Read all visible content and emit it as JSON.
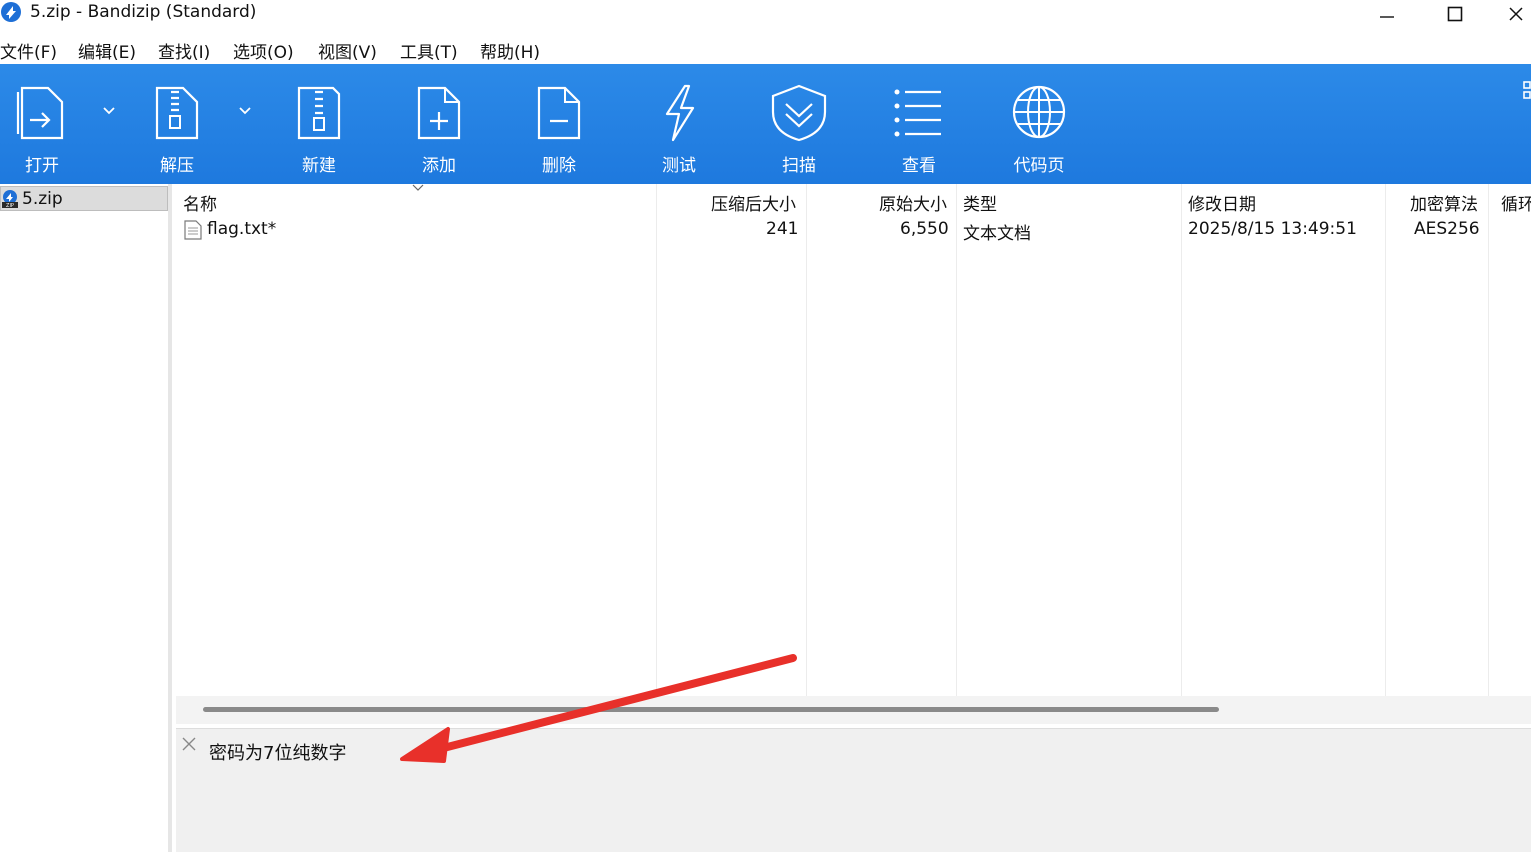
{
  "window": {
    "title": "5.zip - Bandizip (Standard)"
  },
  "menu": [
    "文件(F)",
    "编辑(E)",
    "查找(I)",
    "选项(O)",
    "视图(V)",
    "工具(T)",
    "帮助(H)"
  ],
  "toolbar": {
    "open": "打开",
    "extract": "解压",
    "new": "新建",
    "add": "添加",
    "delete": "删除",
    "test": "测试",
    "scan": "扫描",
    "view": "查看",
    "codepage": "代码页"
  },
  "tree": {
    "archive": "5.zip"
  },
  "columns": {
    "name": "名称",
    "compressed": "压缩后大小",
    "original": "原始大小",
    "type": "类型",
    "modified": "修改日期",
    "encryption": "加密算法",
    "cycle": "循环"
  },
  "files": [
    {
      "name": "flag.txt*",
      "compressed": "241",
      "original": "6,550",
      "type": "文本文档",
      "modified": "2025/8/15 13:49:51",
      "encryption": "AES256"
    }
  ],
  "comment": {
    "text": "密码为7位纯数字"
  },
  "colors": {
    "toolbar": "#1e79de",
    "annotation": "#e8302a"
  },
  "icons": [
    "bandizip-logo-icon",
    "minimize-icon",
    "maximize-icon",
    "close-icon",
    "open-icon",
    "extract-icon",
    "new-archive-icon",
    "add-file-icon",
    "delete-file-icon",
    "test-icon",
    "scan-shield-icon",
    "view-list-icon",
    "globe-icon",
    "zip-file-icon",
    "text-file-icon",
    "chevron-down-icon"
  ]
}
